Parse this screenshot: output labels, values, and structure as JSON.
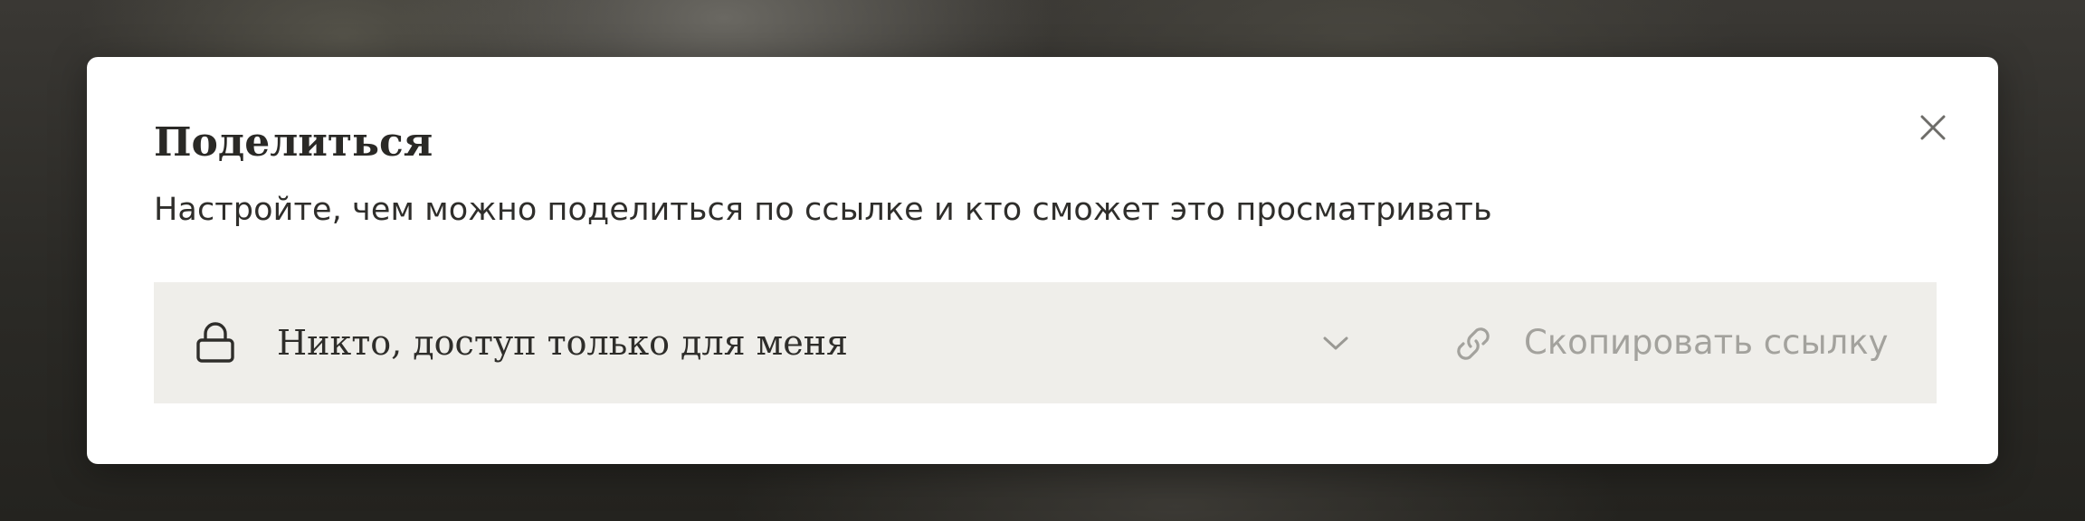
{
  "dialog": {
    "title": "Поделиться",
    "description": "Настройте, чем можно поделиться по ссылке и кто сможет это просматривать",
    "close_icon": "close-icon"
  },
  "share": {
    "access": {
      "icon": "lock-icon",
      "selected_label": "Никто, доступ только для меня",
      "dropdown_icon": "chevron-down-icon"
    },
    "copy_link": {
      "icon": "link-icon",
      "label": "Скопировать ссылку",
      "disabled": true
    }
  },
  "colors": {
    "overlay": "#2b2a26",
    "dialog_background": "#ffffff",
    "row_background": "#efeeea",
    "text_primary": "#2a2926",
    "text_disabled": "#a3a29d"
  }
}
